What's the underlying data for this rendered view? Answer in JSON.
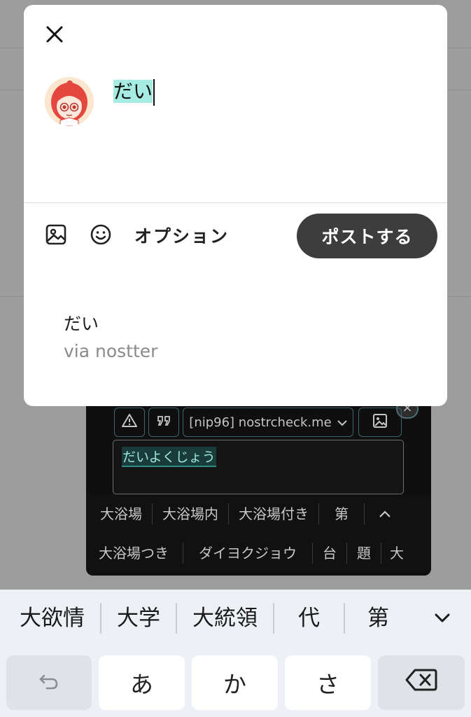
{
  "background": {
    "timestamps": [
      "0",
      "0"
    ]
  },
  "compose_modal": {
    "close_icon": "close-icon",
    "input_text": "だい",
    "toolbar": {
      "image_icon": "image-icon",
      "emoji_icon": "emoji-icon",
      "options_label": "オプション",
      "post_label": "ポストする"
    },
    "preview": {
      "text": "だい",
      "via": "via nostter"
    }
  },
  "dark_composer": {
    "warning_icon": "warning-icon",
    "quote_icon": "quote-icon",
    "upload_server": "[nip96] nostrcheck.me",
    "image_icon": "image-icon",
    "textarea_value": "だいよくじょう",
    "candidates_row1": [
      "大浴場",
      "大浴場内",
      "大浴場付き",
      "第"
    ],
    "candidates_row2": [
      "大浴場つき",
      "ダイヨクジョウ",
      "台",
      "題",
      "大"
    ]
  },
  "keyboard": {
    "candidates": [
      "大欲情",
      "大学",
      "大統領",
      "代",
      "第"
    ],
    "keys": {
      "undo_icon": "undo-icon",
      "a": "あ",
      "ka": "か",
      "sa": "さ",
      "backspace_icon": "backspace-icon"
    }
  },
  "colors": {
    "post_button": "#3d3d3d",
    "input_highlight": "#a6ece3",
    "dark_accent": "#3e6470"
  }
}
